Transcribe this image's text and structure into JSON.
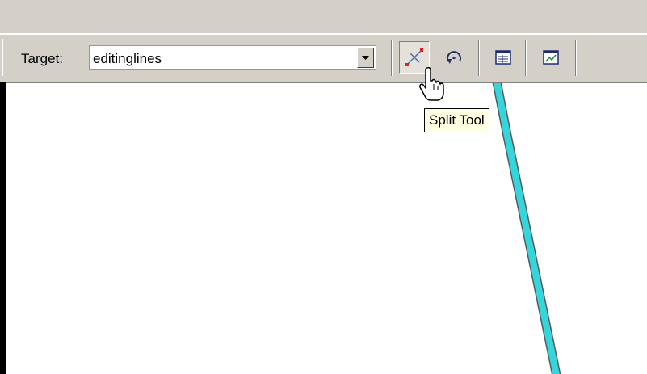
{
  "toolbar": {
    "target_label": "Target:",
    "target_value": "editinglines",
    "tools": [
      {
        "name": "split-tool",
        "icon": "split-line-icon"
      },
      {
        "name": "rotate-tool",
        "icon": "rotate-icon"
      },
      {
        "name": "attributes",
        "icon": "attributes-table-icon"
      },
      {
        "name": "sketch-properties",
        "icon": "sketch-properties-icon"
      }
    ]
  },
  "tooltip": {
    "text": "Split Tool"
  },
  "colors": {
    "chrome": "#d4d0c8",
    "map_background": "#ffffff",
    "line_fill": "#33d6dc",
    "line_outline": "#5a5a5a",
    "tooltip_bg": "#ffffe1"
  }
}
